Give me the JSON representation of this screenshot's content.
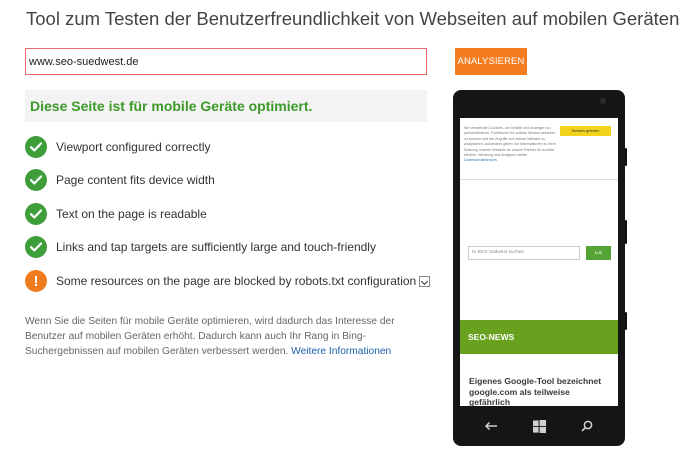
{
  "page": {
    "title": "Tool zum Testen der Benutzerfreundlichkeit von Webseiten auf mobilen Geräten",
    "info_icon": "i"
  },
  "form": {
    "url_value": "www.seo-suedwest.de",
    "analyze_label": "ANALYSIEREN"
  },
  "result": {
    "headline": "Diese Seite ist für mobile Geräte optimiert.",
    "checks": [
      {
        "icon": "check-icon",
        "text": "Viewport configured correctly"
      },
      {
        "icon": "check-icon",
        "text": "Page content fits device width"
      },
      {
        "icon": "check-icon",
        "text": "Text on the page is readable"
      },
      {
        "icon": "check-icon",
        "text": "Links and tap targets are sufficiently large and touch-friendly"
      },
      {
        "icon": "warning-icon",
        "text": "Some resources on the page are blocked by robots.txt configuration",
        "warning_glyph": "!"
      }
    ],
    "footnote": "Wenn Sie die Seiten für mobile Geräte optimieren, wird dadurch das Interesse der Benutzer auf mobilen Geräten erhöht. Dadurch kann auch Ihr Rang in Bing-Suchergebnissen auf mobilen Geräten verbessert werden.",
    "more_link": "Weitere Informationen"
  },
  "preview": {
    "cookie_text": "Wir verwenden Cookies, um Inhalte und Anzeigen zu personalisieren, Funktionen für soziale Medien anbieten zu können und die Zugriffe auf unsere Website zu analysieren. Außerdem geben wir Informationen zu Ihrer Nutzung unserer Website an unsere Partner für soziale Medien, Werbung und Analysen weiter.",
    "cookie_link": "Datenschutzhinweis",
    "cookie_button": "Hinweis gelesen",
    "search_placeholder": "In SEO Südwest suchen",
    "search_button": "Los",
    "news_header": "SEO-NEWS",
    "news_title": "Eigenes Google-Tool bezeichnet google.com als teilweise gefährlich"
  },
  "colors": {
    "accent_orange": "#f57d1f",
    "success_green": "#3c9a29",
    "input_border": "#e8686a",
    "news_green": "#67a11d"
  }
}
